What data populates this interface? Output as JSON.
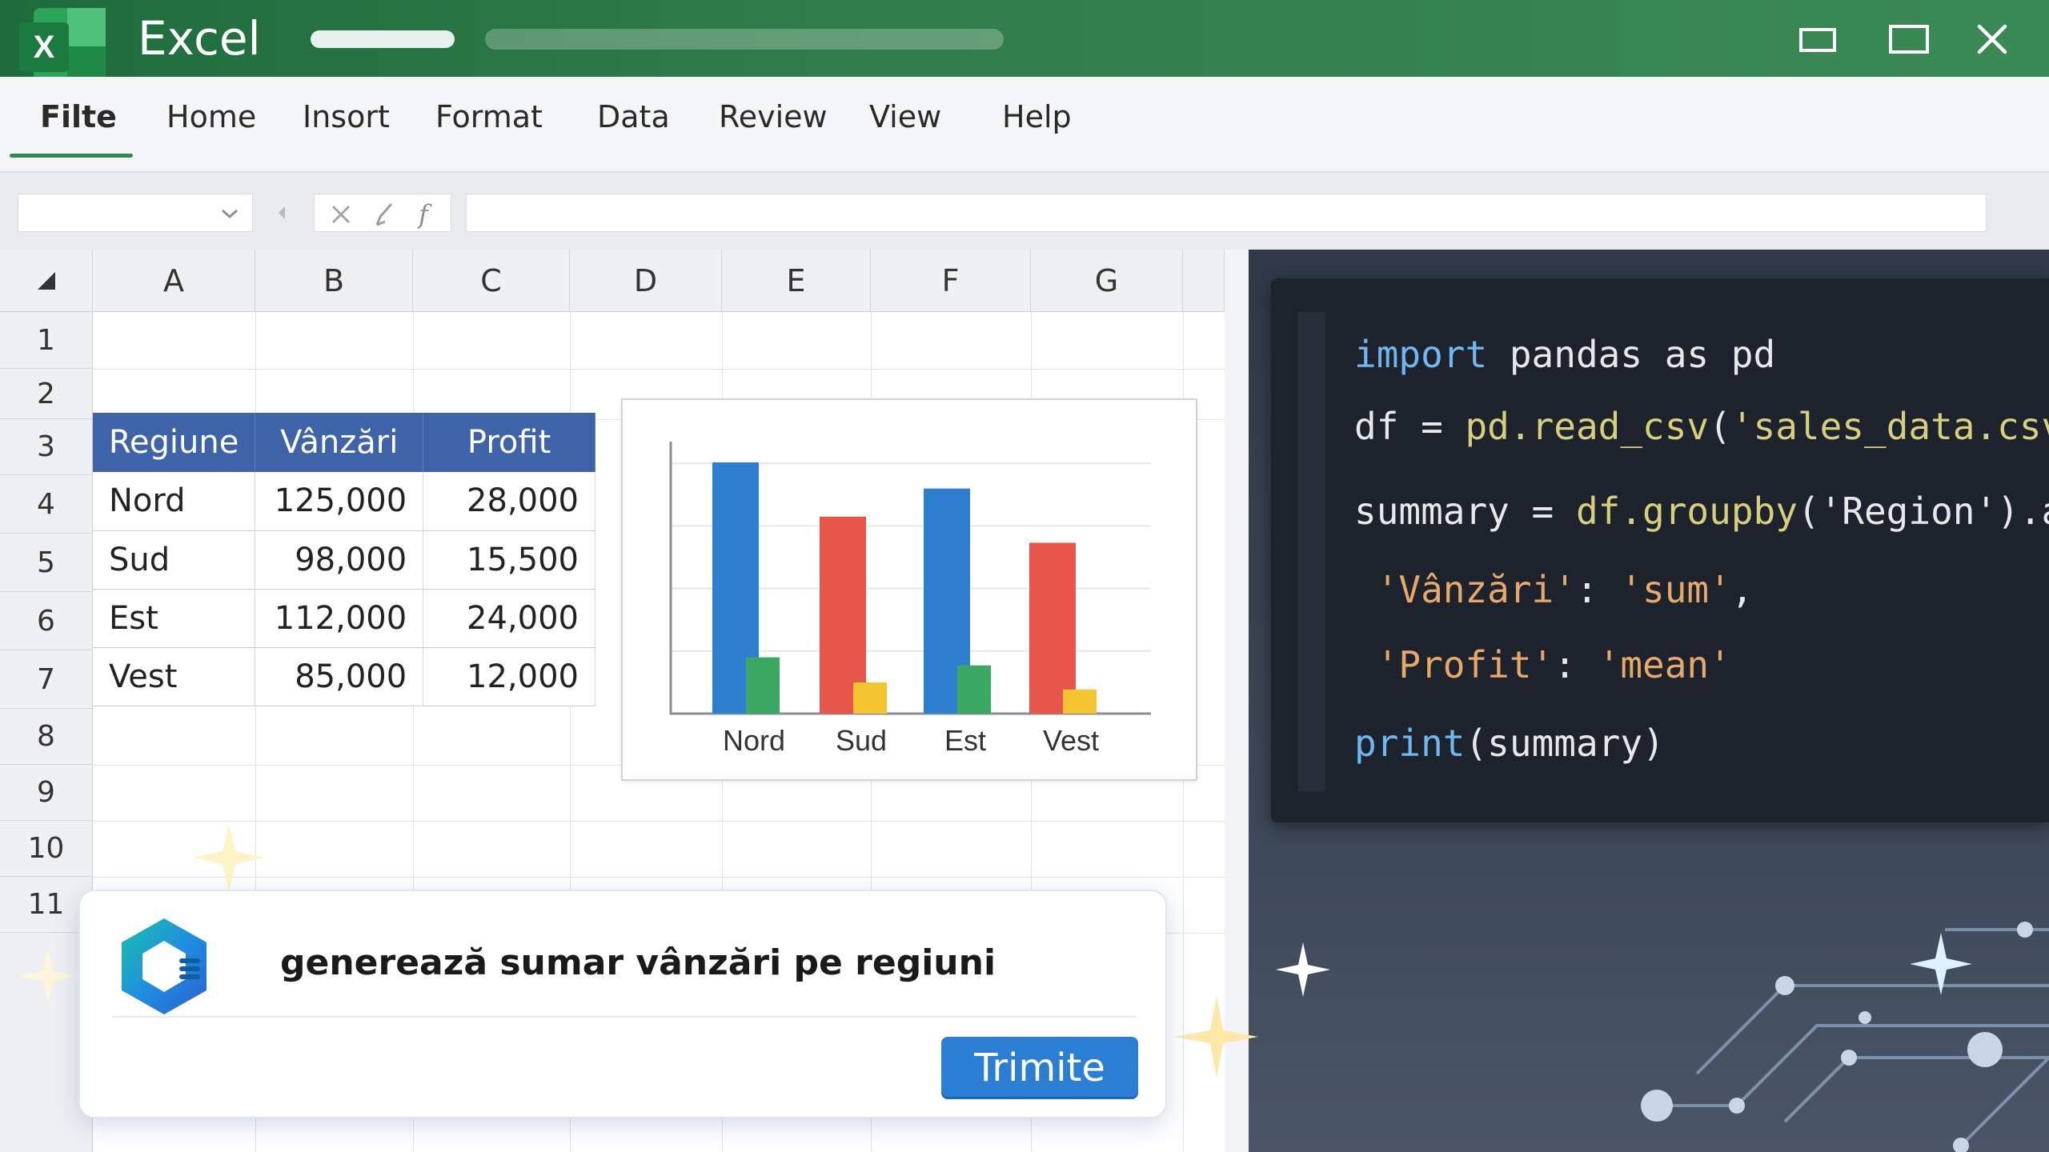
{
  "window": {
    "app_title": "Excel",
    "logo_letter": "X",
    "controls": [
      "minimize-icon",
      "maximize-icon",
      "close-icon"
    ]
  },
  "ribbon": {
    "tabs": [
      {
        "label": "Filte",
        "active": true
      },
      {
        "label": "Home"
      },
      {
        "label": "Insort"
      },
      {
        "label": "Format"
      },
      {
        "label": "Data"
      },
      {
        "label": "Review"
      },
      {
        "label": "View"
      },
      {
        "label": "Help"
      }
    ]
  },
  "formula_bar": {
    "name_box_value": "",
    "formula_value": "",
    "icons": [
      "cancel-icon",
      "enter-icon",
      "function-icon"
    ]
  },
  "grid": {
    "columns": [
      "A",
      "B",
      "C",
      "D",
      "E",
      "F",
      "G"
    ],
    "rows": [
      "1",
      "2",
      "3",
      "4",
      "5",
      "6",
      "7",
      "8",
      "9",
      "10",
      "11"
    ]
  },
  "table": {
    "headers": [
      "Regiune",
      "Vânzări",
      "Profit"
    ],
    "rows": [
      [
        "Nord",
        "125,000",
        "28,000"
      ],
      [
        "Sud",
        "98,000",
        "15,500"
      ],
      [
        "Est",
        "112,000",
        "24,000"
      ],
      [
        "Vest",
        "85,000",
        "12,000"
      ]
    ]
  },
  "chart_data": {
    "type": "bar",
    "categories": [
      "Nord",
      "Sud",
      "Est",
      "Vest"
    ],
    "series": [
      {
        "values": [
          125000,
          98000,
          112000,
          85000
        ]
      },
      {
        "values": [
          28000,
          15500,
          24000,
          12000
        ]
      }
    ],
    "bar_colors": [
      [
        "#2f7fd1",
        "#3aa861"
      ],
      [
        "#e8564b",
        "#f5c431"
      ],
      [
        "#2f7fd1",
        "#3aa861"
      ],
      [
        "#e8564b",
        "#f5c431"
      ]
    ],
    "title": "",
    "xlabel": "",
    "ylabel": "",
    "grid": true,
    "legend": "none"
  },
  "code": {
    "lines": [
      [
        {
          "t": "import",
          "c": "kw"
        },
        {
          "t": " pandas as pd",
          "c": ""
        }
      ],
      [
        {
          "t": "df = ",
          "c": ""
        },
        {
          "t": "pd.read_csv",
          "c": "fn"
        },
        {
          "t": "(",
          "c": ""
        },
        {
          "t": "'sales_data.csv'",
          "c": "fn"
        },
        {
          "t": ")",
          "c": ""
        }
      ],
      [
        {
          "t": "summary = ",
          "c": ""
        },
        {
          "t": "df.groupby",
          "c": "fn"
        },
        {
          "t": "('Region').agg",
          "c": ""
        }
      ],
      [
        {
          "t": " 'Vânzări'",
          "c": "str"
        },
        {
          "t": ": ",
          "c": ""
        },
        {
          "t": "'sum'",
          "c": "str"
        },
        {
          "t": ",",
          "c": ""
        }
      ],
      [
        {
          "t": " 'Profit'",
          "c": "str"
        },
        {
          "t": ": ",
          "c": ""
        },
        {
          "t": "'mean'",
          "c": "str"
        }
      ],
      [
        {
          "t": "print",
          "c": "kw"
        },
        {
          "t": "(summary)",
          "c": ""
        }
      ]
    ]
  },
  "prompt": {
    "text": "generează sumar vânzări pe regiuni",
    "send_label": "Trimite"
  },
  "colors": {
    "title_bar": "#2f7d4a",
    "table_header": "#3f63a8",
    "send_button": "#2a7fd4",
    "code_bg": "#1c232d"
  }
}
